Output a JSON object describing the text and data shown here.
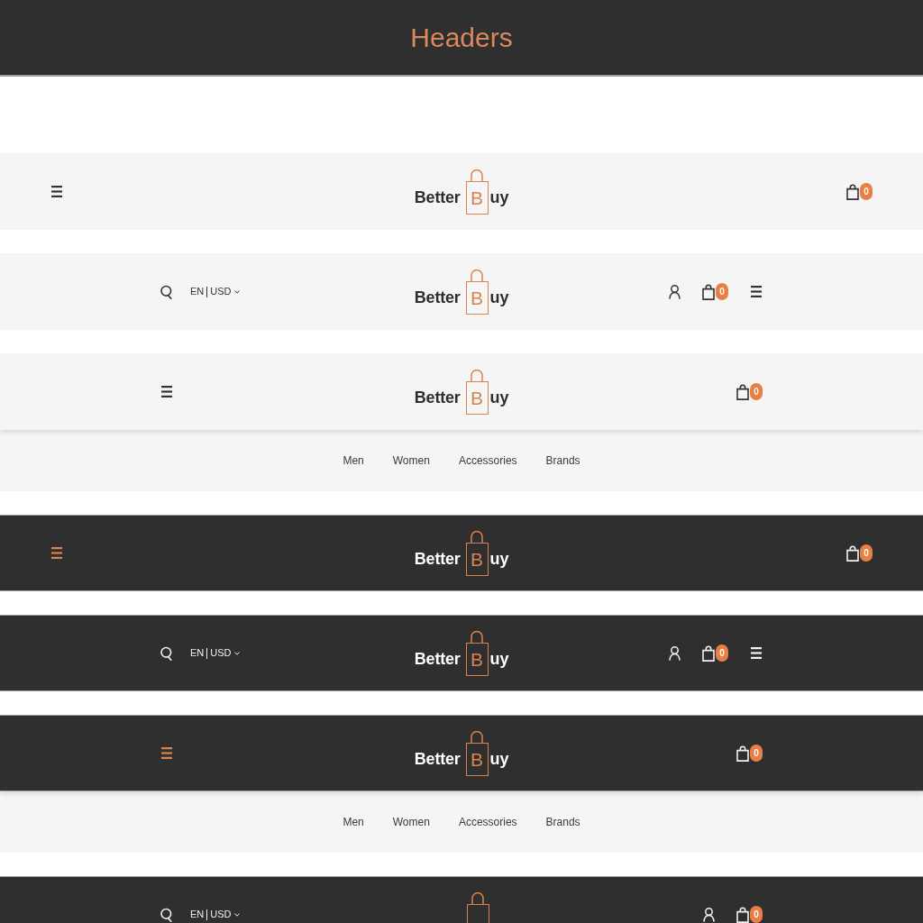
{
  "page_title": "Headers",
  "headers": [
    {
      "kind": "light",
      "full_width": true,
      "left": [
        {
          "kind": "menu",
          "highlighted": false
        }
      ],
      "logo": {
        "first": "Better",
        "initial": "B",
        "rest": "uy"
      },
      "right": [
        {
          "kind": "cart",
          "count": "0"
        }
      ]
    },
    {
      "kind": "light",
      "full_width": false,
      "left": [
        {
          "kind": "search"
        },
        {
          "kind": "language",
          "language": "EN",
          "currency": "USD"
        }
      ],
      "logo": {
        "first": "Better",
        "initial": "B",
        "rest": "uy"
      },
      "right": [
        {
          "kind": "account"
        },
        {
          "kind": "cart",
          "count": "0"
        },
        {
          "kind": "menu",
          "highlighted": false
        }
      ]
    },
    {
      "kind": "light",
      "full_width": false,
      "left": [
        {
          "kind": "menu",
          "highlighted": false
        }
      ],
      "logo": {
        "first": "Better",
        "initial": "B",
        "rest": "uy"
      },
      "right": [
        {
          "kind": "cart",
          "count": "0"
        }
      ],
      "nav": [
        "Men",
        "Women",
        "Accessories",
        "Brands"
      ]
    },
    {
      "kind": "dark",
      "full_width": true,
      "left": [
        {
          "kind": "menu",
          "highlighted": true
        }
      ],
      "logo": {
        "first": "Better",
        "initial": "B",
        "rest": "uy"
      },
      "right": [
        {
          "kind": "cart",
          "count": "0"
        }
      ]
    },
    {
      "kind": "dark",
      "full_width": false,
      "left": [
        {
          "kind": "search"
        },
        {
          "kind": "language",
          "language": "EN",
          "currency": "USD"
        }
      ],
      "logo": {
        "first": "Better",
        "initial": "B",
        "rest": "uy"
      },
      "right": [
        {
          "kind": "account"
        },
        {
          "kind": "cart",
          "count": "0"
        },
        {
          "kind": "menu",
          "highlighted": false
        }
      ]
    },
    {
      "kind": "dark",
      "full_width": false,
      "left": [
        {
          "kind": "menu",
          "highlighted": true
        }
      ],
      "logo": {
        "first": "Better",
        "initial": "B",
        "rest": "uy"
      },
      "right": [
        {
          "kind": "cart",
          "count": "0"
        }
      ],
      "nav": [
        "Men",
        "Women",
        "Accessories",
        "Brands"
      ]
    },
    {
      "kind": "dark",
      "full_width": false,
      "left": [
        {
          "kind": "search"
        },
        {
          "kind": "language",
          "language": "EN",
          "currency": "USD"
        }
      ],
      "right": [
        {
          "kind": "account"
        },
        {
          "kind": "cart",
          "count": "0"
        }
      ]
    }
  ]
}
